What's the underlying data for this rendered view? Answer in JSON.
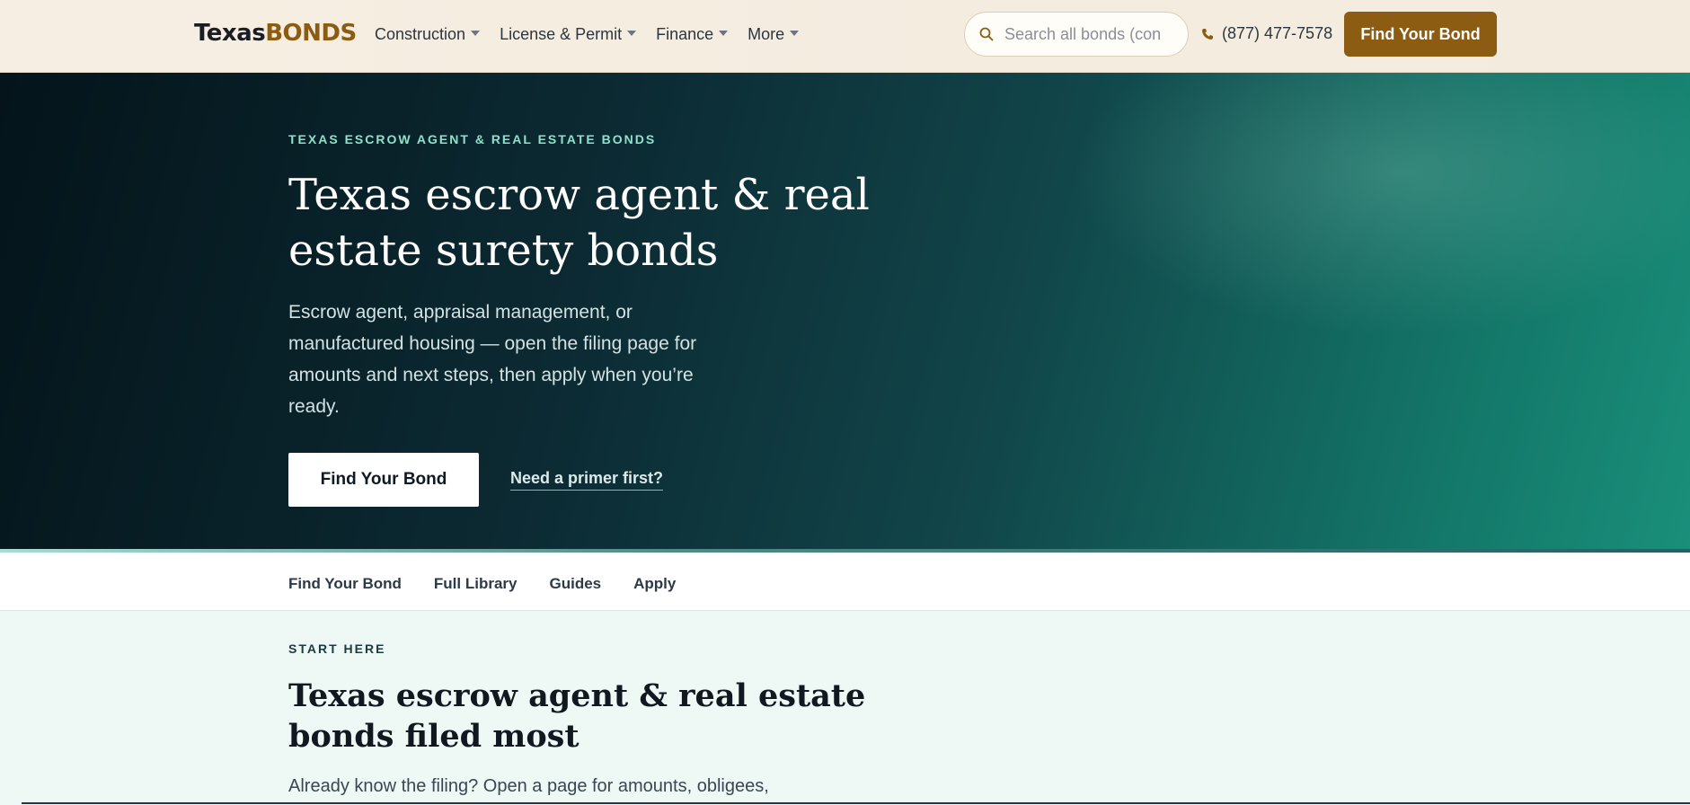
{
  "header": {
    "logo_part1": "Texas",
    "logo_part2": "BONDS",
    "nav": [
      {
        "label": "Construction"
      },
      {
        "label": "License & Permit"
      },
      {
        "label": "Finance"
      },
      {
        "label": "More"
      }
    ],
    "search_placeholder": "Search all bonds (con",
    "phone": "(877) 477-7578",
    "cta_label": "Find Your Bond"
  },
  "hero": {
    "eyebrow": "TEXAS ESCROW AGENT & REAL ESTATE BONDS",
    "title": "Texas escrow agent & real estate surety bonds",
    "subtitle": "Escrow agent, appraisal management, or manufactured housing — open the filing page for amounts and next steps, then apply when you’re ready.",
    "primary_button": "Find Your Bond",
    "secondary_link": "Need a primer first?"
  },
  "subnav": {
    "items": [
      {
        "label": "Find Your Bond"
      },
      {
        "label": "Full Library"
      },
      {
        "label": "Guides"
      },
      {
        "label": "Apply"
      }
    ]
  },
  "start_section": {
    "eyebrow": "START HERE",
    "title": "Texas escrow agent & real estate bonds filed most",
    "subtitle": "Already know the filing? Open a page for amounts, obligees,"
  },
  "colors": {
    "brand_gold": "#8b5c12",
    "hero_teal": "#1a8f7a",
    "eyebrow_mint": "#8fe0cc"
  }
}
